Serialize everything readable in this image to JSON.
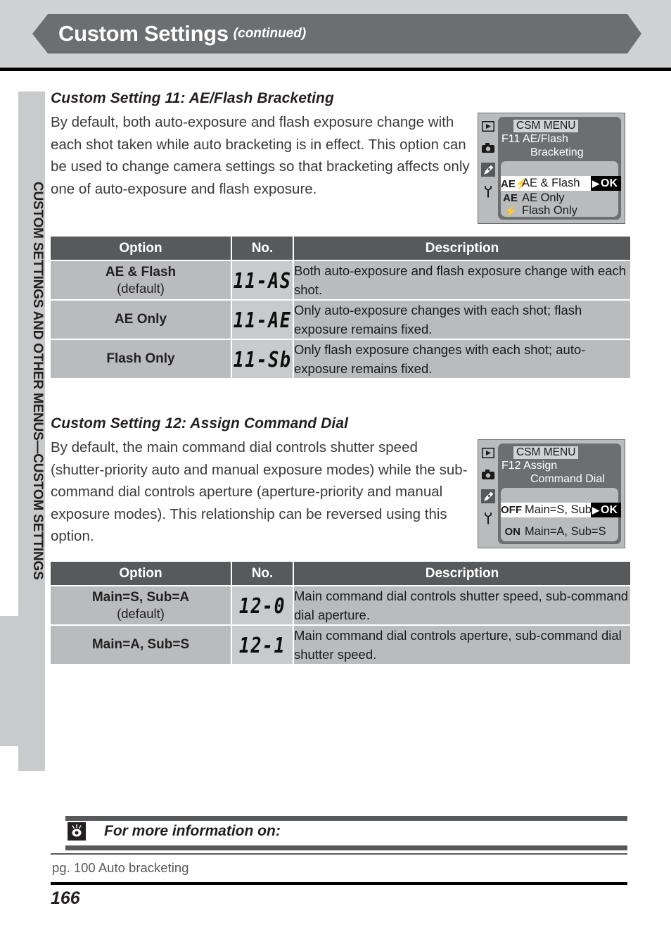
{
  "header": {
    "title": "Custom Settings",
    "subtitle": "(continued)",
    "banner_color": "#6d6e70",
    "band_color": "#d0d2d3"
  },
  "sidebar": {
    "tab_label": "CUSTOM SETTINGS AND OTHER MENUS—CUSTOM SETTINGS",
    "tab_color": "#c8cacb"
  },
  "sections": [
    {
      "heading": "Custom Setting 11: AE/Flash Bracketing",
      "body": "By default, both auto-exposure and flash exposure change with each shot taken while auto bracketing is in effect. This option can be used to change camera settings so that bracketing affects only one of auto-exposure and flash exposure.",
      "lcd": {
        "menu_title": "CSM MENU",
        "line1": "F11  AE/Flash",
        "line2": "Bracketing",
        "rows": [
          {
            "icon": "AE⚡",
            "label": "AE & Flash",
            "selected": true
          },
          {
            "icon": "AE",
            "label": "AE Only",
            "selected": false
          },
          {
            "icon": "⚡",
            "label": "Flash Only",
            "selected": false
          }
        ],
        "ok_label": "OK",
        "rail_icons": [
          "playback-icon",
          "camera-icon",
          "pencil-icon",
          "wrench-icon"
        ],
        "rail_selected_index": 2
      },
      "table": {
        "headers": [
          "Option",
          "No.",
          "Description"
        ],
        "rows": [
          {
            "option": "AE & Flash",
            "default_note": "(default)",
            "no": "11-AS",
            "description": "Both auto-exposure and flash exposure change with each shot."
          },
          {
            "option": "AE Only",
            "default_note": "",
            "no": "11-AE",
            "description": "Only auto-exposure changes with each shot; flash exposure remains fixed."
          },
          {
            "option": "Flash Only",
            "default_note": "",
            "no": "11-Sb",
            "description": "Only flash exposure changes with each shot; auto-exposure remains fixed."
          }
        ]
      }
    },
    {
      "heading": "Custom Setting 12: Assign Command Dial",
      "body": "By default, the main command dial controls shutter speed (shutter-priority auto and manual exposure modes) while the sub-command dial controls aperture (aperture-priority and manual exposure modes). This relationship can be reversed using this option.",
      "lcd": {
        "menu_title": "CSM MENU",
        "line1": "F12  Assign",
        "line2": "Command Dial",
        "rows": [
          {
            "icon": "OFF",
            "label": "Main=S, Sub=A",
            "selected": true
          },
          {
            "icon": "ON",
            "label": "Main=A, Sub=S",
            "selected": false
          }
        ],
        "ok_label": "OK",
        "rail_icons": [
          "playback-icon",
          "camera-icon",
          "pencil-icon",
          "wrench-icon"
        ],
        "rail_selected_index": 2
      },
      "table": {
        "headers": [
          "Option",
          "No.",
          "Description"
        ],
        "rows": [
          {
            "option": "Main=S, Sub=A",
            "default_note": "(default)",
            "no": "12-0",
            "description": "Main command dial controls shutter speed, sub-command dial aperture."
          },
          {
            "option": "Main=A, Sub=S",
            "default_note": "",
            "no": "12-1",
            "description": "Main command dial controls aperture, sub-command dial shutter speed."
          }
        ]
      }
    }
  ],
  "footer": {
    "title": "For more information on:",
    "reference": "pg. 100  Auto bracketing",
    "page_number": "166"
  }
}
